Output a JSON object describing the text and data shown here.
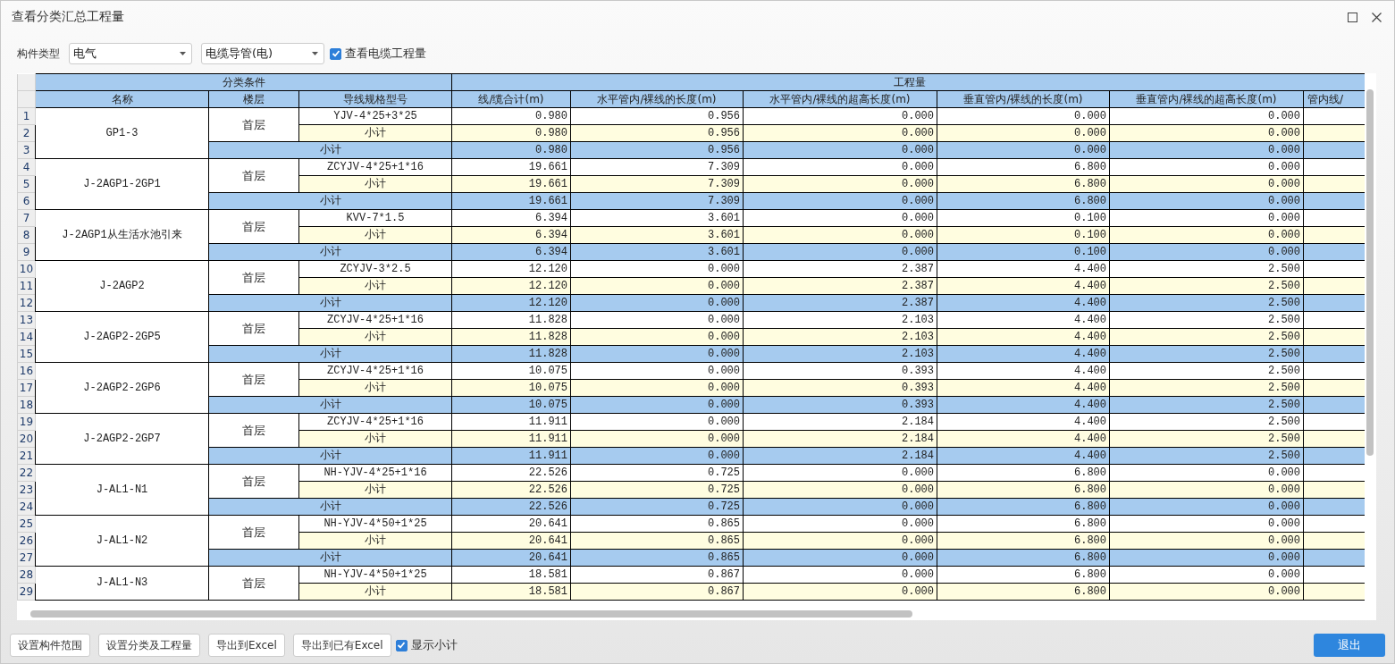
{
  "window": {
    "title": "查看分类汇总工程量"
  },
  "filters": {
    "label": "构件类型",
    "dropdowns": [
      {
        "value": "电气"
      },
      {
        "value": "电缆导管(电)"
      }
    ],
    "checkbox": {
      "label": "查看电缆工程量",
      "checked": true
    }
  },
  "table": {
    "group_headers": [
      {
        "label": "分类条件"
      },
      {
        "label": "工程量"
      }
    ],
    "columns": [
      "名称",
      "楼层",
      "导线规格型号",
      "线/缆合计(m)",
      "水平管内/裸线的长度(m)",
      "水平管内/裸线的超高长度(m)",
      "垂直管内/裸线的长度(m)",
      "垂直管内/裸线的超高长度(m)",
      "管内线/"
    ],
    "groups": [
      {
        "name": "GP1-3",
        "floor": "首层",
        "rows": [
          {
            "kind": "item",
            "no": "1",
            "label": "YJV-4*25+3*25",
            "values": [
              "0.980",
              "0.956",
              "0.000",
              "0.000",
              "0.000"
            ]
          },
          {
            "kind": "floor_subtotal",
            "no": "2",
            "label": "小计",
            "values": [
              "0.980",
              "0.956",
              "0.000",
              "0.000",
              "0.000"
            ]
          },
          {
            "kind": "subtotal",
            "no": "3",
            "label": "小计",
            "values": [
              "0.980",
              "0.956",
              "0.000",
              "0.000",
              "0.000"
            ]
          }
        ]
      },
      {
        "name": "J-2AGP1-2GP1",
        "floor": "首层",
        "rows": [
          {
            "kind": "item",
            "no": "4",
            "label": "ZCYJV-4*25+1*16",
            "values": [
              "19.661",
              "7.309",
              "0.000",
              "6.800",
              "0.000"
            ]
          },
          {
            "kind": "floor_subtotal",
            "no": "5",
            "label": "小计",
            "values": [
              "19.661",
              "7.309",
              "0.000",
              "6.800",
              "0.000"
            ]
          },
          {
            "kind": "subtotal",
            "no": "6",
            "label": "小计",
            "values": [
              "19.661",
              "7.309",
              "0.000",
              "6.800",
              "0.000"
            ]
          }
        ]
      },
      {
        "name": "J-2AGP1从生活水池引来",
        "floor": "首层",
        "rows": [
          {
            "kind": "item",
            "no": "7",
            "label": "KVV-7*1.5",
            "values": [
              "6.394",
              "3.601",
              "0.000",
              "0.100",
              "0.000"
            ]
          },
          {
            "kind": "floor_subtotal",
            "no": "8",
            "label": "小计",
            "values": [
              "6.394",
              "3.601",
              "0.000",
              "0.100",
              "0.000"
            ]
          },
          {
            "kind": "subtotal",
            "no": "9",
            "label": "小计",
            "values": [
              "6.394",
              "3.601",
              "0.000",
              "0.100",
              "0.000"
            ]
          }
        ]
      },
      {
        "name": "J-2AGP2",
        "floor": "首层",
        "rows": [
          {
            "kind": "item",
            "no": "10",
            "label": "ZCYJV-3*2.5",
            "values": [
              "12.120",
              "0.000",
              "2.387",
              "4.400",
              "2.500"
            ]
          },
          {
            "kind": "floor_subtotal",
            "no": "11",
            "label": "小计",
            "values": [
              "12.120",
              "0.000",
              "2.387",
              "4.400",
              "2.500"
            ]
          },
          {
            "kind": "subtotal",
            "no": "12",
            "label": "小计",
            "values": [
              "12.120",
              "0.000",
              "2.387",
              "4.400",
              "2.500"
            ]
          }
        ]
      },
      {
        "name": "J-2AGP2-2GP5",
        "floor": "首层",
        "rows": [
          {
            "kind": "item",
            "no": "13",
            "label": "ZCYJV-4*25+1*16",
            "values": [
              "11.828",
              "0.000",
              "2.103",
              "4.400",
              "2.500"
            ]
          },
          {
            "kind": "floor_subtotal",
            "no": "14",
            "label": "小计",
            "values": [
              "11.828",
              "0.000",
              "2.103",
              "4.400",
              "2.500"
            ]
          },
          {
            "kind": "subtotal",
            "no": "15",
            "label": "小计",
            "values": [
              "11.828",
              "0.000",
              "2.103",
              "4.400",
              "2.500"
            ]
          }
        ]
      },
      {
        "name": "J-2AGP2-2GP6",
        "floor": "首层",
        "rows": [
          {
            "kind": "item",
            "no": "16",
            "label": "ZCYJV-4*25+1*16",
            "values": [
              "10.075",
              "0.000",
              "0.393",
              "4.400",
              "2.500"
            ]
          },
          {
            "kind": "floor_subtotal",
            "no": "17",
            "label": "小计",
            "values": [
              "10.075",
              "0.000",
              "0.393",
              "4.400",
              "2.500"
            ]
          },
          {
            "kind": "subtotal",
            "no": "18",
            "label": "小计",
            "values": [
              "10.075",
              "0.000",
              "0.393",
              "4.400",
              "2.500"
            ]
          }
        ]
      },
      {
        "name": "J-2AGP2-2GP7",
        "floor": "首层",
        "rows": [
          {
            "kind": "item",
            "no": "19",
            "label": "ZCYJV-4*25+1*16",
            "values": [
              "11.911",
              "0.000",
              "2.184",
              "4.400",
              "2.500"
            ]
          },
          {
            "kind": "floor_subtotal",
            "no": "20",
            "label": "小计",
            "values": [
              "11.911",
              "0.000",
              "2.184",
              "4.400",
              "2.500"
            ]
          },
          {
            "kind": "subtotal",
            "no": "21",
            "label": "小计",
            "values": [
              "11.911",
              "0.000",
              "2.184",
              "4.400",
              "2.500"
            ]
          }
        ]
      },
      {
        "name": "J-AL1-N1",
        "floor": "首层",
        "rows": [
          {
            "kind": "item",
            "no": "22",
            "label": "NH-YJV-4*25+1*16",
            "values": [
              "22.526",
              "0.725",
              "0.000",
              "6.800",
              "0.000"
            ]
          },
          {
            "kind": "floor_subtotal",
            "no": "23",
            "label": "小计",
            "values": [
              "22.526",
              "0.725",
              "0.000",
              "6.800",
              "0.000"
            ]
          },
          {
            "kind": "subtotal",
            "no": "24",
            "label": "小计",
            "values": [
              "22.526",
              "0.725",
              "0.000",
              "6.800",
              "0.000"
            ]
          }
        ]
      },
      {
        "name": "J-AL1-N2",
        "floor": "首层",
        "rows": [
          {
            "kind": "item",
            "no": "25",
            "label": "NH-YJV-4*50+1*25",
            "values": [
              "20.641",
              "0.865",
              "0.000",
              "6.800",
              "0.000"
            ]
          },
          {
            "kind": "floor_subtotal",
            "no": "26",
            "label": "小计",
            "values": [
              "20.641",
              "0.865",
              "0.000",
              "6.800",
              "0.000"
            ]
          },
          {
            "kind": "subtotal",
            "no": "27",
            "label": "小计",
            "values": [
              "20.641",
              "0.865",
              "0.000",
              "6.800",
              "0.000"
            ]
          }
        ]
      },
      {
        "name": "J-AL1-N3",
        "floor": "首层",
        "rows": [
          {
            "kind": "item",
            "no": "28",
            "label": "NH-YJV-4*50+1*25",
            "values": [
              "18.581",
              "0.867",
              "0.000",
              "6.800",
              "0.000"
            ]
          },
          {
            "kind": "floor_subtotal",
            "no": "29",
            "label": "小计",
            "values": [
              "18.581",
              "0.867",
              "0.000",
              "6.800",
              "0.000"
            ]
          }
        ]
      }
    ]
  },
  "footer": {
    "buttons": [
      "设置构件范围",
      "设置分类及工程量",
      "导出到Excel",
      "导出到已有Excel"
    ],
    "checkbox": {
      "label": "显示小计",
      "checked": true
    },
    "exit_button": "退出"
  }
}
